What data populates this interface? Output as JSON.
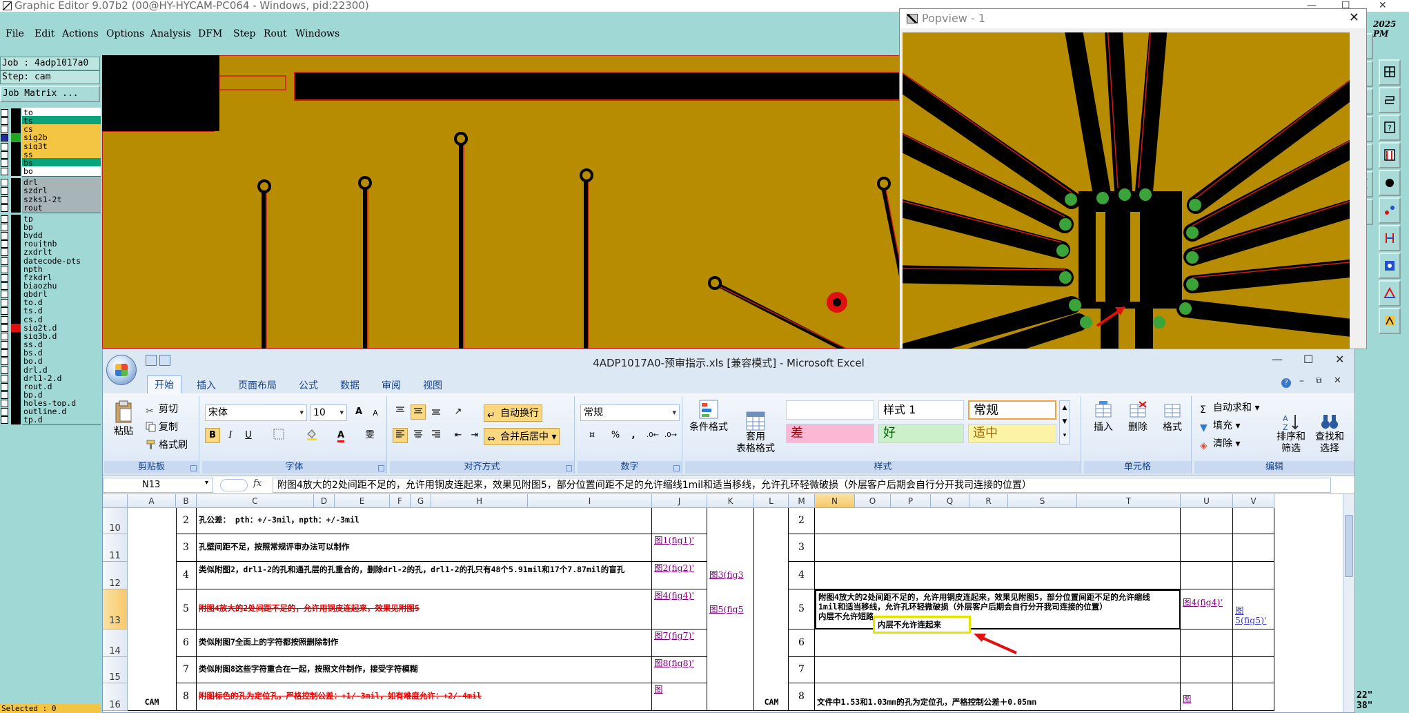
{
  "editor": {
    "title": "Graphic Editor 9.07b2 (00@HY-HYCAM-PC064 - Windows, pid:22300)",
    "menu": [
      "File",
      "Edit",
      "Actions",
      "Options",
      "Analysis",
      "DFM",
      "Step",
      "Rout",
      "Windows"
    ],
    "clock": [
      "2025",
      "PM"
    ],
    "job": "Job : 4adp1017a0",
    "step": "Step: cam",
    "job_matrix": "Job Matrix ...",
    "layers": [
      {
        "name": "to",
        "color": "#ffffff",
        "swatch": "#000000"
      },
      {
        "name": "ts",
        "color": "#0aa37a",
        "swatch": "#000000"
      },
      {
        "name": "cs",
        "color": "#f4c542",
        "swatch": "#000000"
      },
      {
        "name": "sig2b",
        "color": "#f4c542",
        "swatch": "#1fa81f",
        "active": true
      },
      {
        "name": "sig3t",
        "color": "#f4c542",
        "swatch": "#000000"
      },
      {
        "name": "ss",
        "color": "#f4c542",
        "swatch": "#000000"
      },
      {
        "name": "bs",
        "color": "#0aa37a",
        "swatch": "#000000"
      },
      {
        "name": "bo",
        "color": "#ffffff",
        "swatch": "#000000"
      },
      {
        "name": "drl",
        "color": "#a8b5b8",
        "swatch": "#000000"
      },
      {
        "name": "szdrl",
        "color": "#a8b5b8",
        "swatch": "#000000"
      },
      {
        "name": "szks1-2t",
        "color": "#a8b5b8",
        "swatch": "#000000"
      },
      {
        "name": "rout",
        "color": "#a8b5b8",
        "swatch": "#000000"
      },
      {
        "name": "tp",
        "color": "#9fd8d4",
        "swatch": "#000000"
      },
      {
        "name": "bp",
        "color": "#9fd8d4",
        "swatch": "#000000"
      },
      {
        "name": "bydd",
        "color": "#9fd8d4",
        "swatch": "#000000"
      },
      {
        "name": "roujtnb",
        "color": "#9fd8d4",
        "swatch": "#000000"
      },
      {
        "name": "zxdrlt",
        "color": "#9fd8d4",
        "swatch": "#000000"
      },
      {
        "name": "datecode-pts",
        "color": "#9fd8d4",
        "swatch": "#000000"
      },
      {
        "name": "npth",
        "color": "#9fd8d4",
        "swatch": "#000000"
      },
      {
        "name": "fzkdrl",
        "color": "#9fd8d4",
        "swatch": "#000000"
      },
      {
        "name": "biaozhu",
        "color": "#9fd8d4",
        "swatch": "#000000"
      },
      {
        "name": "gbdrl",
        "color": "#9fd8d4",
        "swatch": "#000000"
      },
      {
        "name": "to.d",
        "color": "#9fd8d4",
        "swatch": "#000000"
      },
      {
        "name": "ts.d",
        "color": "#9fd8d4",
        "swatch": "#000000"
      },
      {
        "name": "cs.d",
        "color": "#9fd8d4",
        "swatch": "#000000"
      },
      {
        "name": "sig2t.d",
        "color": "#9fd8d4",
        "swatch": "#e01010"
      },
      {
        "name": "sig3b.d",
        "color": "#9fd8d4",
        "swatch": "#000000"
      },
      {
        "name": "ss.d",
        "color": "#9fd8d4",
        "swatch": "#000000"
      },
      {
        "name": "bs.d",
        "color": "#9fd8d4",
        "swatch": "#000000"
      },
      {
        "name": "bo.d",
        "color": "#9fd8d4",
        "swatch": "#000000"
      },
      {
        "name": "drl.d",
        "color": "#9fd8d4",
        "swatch": "#000000"
      },
      {
        "name": "drl1-2.d",
        "color": "#9fd8d4",
        "swatch": "#000000"
      },
      {
        "name": "rout.d",
        "color": "#9fd8d4",
        "swatch": "#000000"
      },
      {
        "name": "bp.d",
        "color": "#9fd8d4",
        "swatch": "#000000"
      },
      {
        "name": "holes-top.d",
        "color": "#9fd8d4",
        "swatch": "#000000"
      },
      {
        "name": "outline.d",
        "color": "#9fd8d4",
        "swatch": "#000000"
      },
      {
        "name": "tp.d",
        "color": "#9fd8d4",
        "swatch": "#000000"
      }
    ],
    "selected": "Selected : 0",
    "coords": [
      "22\"",
      "38\""
    ],
    "popview_title": "Popview - 1",
    "colors": {
      "copper": "#b88c00",
      "trace_edge": "#d01a1a",
      "pad": "#3aa33a",
      "background": "#000000"
    }
  },
  "excel": {
    "title": "4ADP1017A0-预审指示.xls  [兼容模式] - Microsoft Excel",
    "tabs": [
      "开始",
      "插入",
      "页面布局",
      "公式",
      "数据",
      "审阅",
      "视图"
    ],
    "clipboard": {
      "paste": "粘贴",
      "cut": "剪切",
      "copy": "复制",
      "format_painter": "格式刷",
      "label": "剪贴板"
    },
    "font": {
      "name": "宋体",
      "size": "10",
      "label": "字体",
      "bold": "B",
      "italic": "I",
      "underline": "U",
      "grow": "A",
      "shrink": "A"
    },
    "align": {
      "wrap": "自动换行",
      "merge": "合并后居中",
      "label": "对齐方式"
    },
    "number": {
      "format": "常规",
      "label": "数字",
      "percent": "%",
      "comma": ","
    },
    "styles": {
      "cond": "条件格式",
      "table": "套用\n表格格式",
      "style1": "样式 1",
      "normal": "常规",
      "bad": "差",
      "good": "好",
      "neutral": "适中",
      "label": "样式"
    },
    "cells": {
      "insert": "插入",
      "delete": "删除",
      "format": "格式",
      "label": "单元格"
    },
    "edit": {
      "autosum": "自动求和",
      "fill": "填充",
      "clear": "清除",
      "sort": "排序和\n筛选",
      "find": "查找和\n选择",
      "label": "编辑"
    },
    "namebox": "N13",
    "fx": "fx",
    "formula": "附图4放大的2处间距不足的，允许用铜皮连起来，效果见附图5，部分位置间距不足的允许缩线1mil和适当移线，允许孔环轻微破损（外层客户后期会自行分开我司连接的位置）",
    "columns": [
      "A",
      "B",
      "C",
      "D",
      "E",
      "F",
      "G",
      "H",
      "I",
      "J",
      "K",
      "L",
      "M",
      "N",
      "O",
      "P",
      "Q",
      "R",
      "S",
      "T",
      "U",
      "V"
    ],
    "rows": [
      {
        "num": "10",
        "idx": "2",
        "text": "孔公差： pth：+/-3mil，npth：+/-3mil",
        "link": "",
        "idx2": "2"
      },
      {
        "num": "11",
        "idx": "3",
        "text": "孔壁间距不足，按照常规评审办法可以制作",
        "link": "图1(fig1)'",
        "idx2": "3"
      },
      {
        "num": "12",
        "idx": "4",
        "text": "类似附图2，drl1-2的孔和通孔层的孔重合的，删除drl-2的孔，drl1-2的孔只有48个5.91mil和17个7.87mil的盲孔",
        "link": "图2(fig2)'",
        "idx2": "4"
      },
      {
        "num": "13",
        "idx": "5",
        "text": "附图4放大的2处间距不足的，允许用铜皮连起来，效果见附图5",
        "link": "图4(fig4)'",
        "idx2": "5"
      },
      {
        "num": "14",
        "idx": "6",
        "text": "类似附图7全面上的字符都按照删除制作",
        "link": "图7(fig7)'",
        "idx2": "6"
      },
      {
        "num": "15",
        "idx": "7",
        "text": "类似附图8这些字符重合在一起，按照文件制作，接受字符模糊",
        "link": "图8(fig8)'",
        "idx2": "7"
      },
      {
        "num": "16",
        "idx": "8",
        "text": "附图标色的孔为定位孔，严格控制公差：+1/-3mil，如有难度允许：+2/-4mil",
        "link": "图",
        "idx2": "8"
      }
    ],
    "k_links": [
      "图3(fig3",
      "图5(fig5"
    ],
    "cam_label": "CAM",
    "n13_text": [
      "附图4放大的2处间距不足的，允许用铜皮连起来，效果见附图5，部分位置间距不足的允许缩线",
      "1mil和适当移线，允许孔环轻微破损（外层客户后期会自行分开我司连接的位置）",
      "内层不允许短路，"
    ],
    "comment": "内层不允许连起来",
    "u_link": "图4(fig4)'",
    "v_link": "图5(fig5)'",
    "n16_text": "文件中1.53和1.03mm的孔为定位孔，严格控制公差＋0.05mm",
    "u16_link": "图"
  }
}
